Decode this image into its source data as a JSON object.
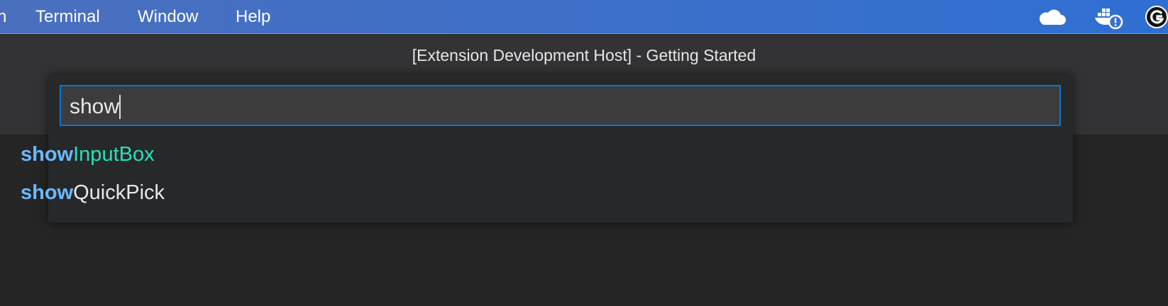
{
  "menubar": {
    "items": [
      {
        "label": "n"
      },
      {
        "label": "Terminal"
      },
      {
        "label": "Window"
      },
      {
        "label": "Help"
      }
    ],
    "tray_icons": [
      "onedrive-cloud-icon",
      "docker-warning-icon",
      "account-circle-icon"
    ]
  },
  "window": {
    "title": "[Extension Development Host] - Getting Started"
  },
  "quick_pick": {
    "input_value": "show",
    "items": [
      {
        "match": "show",
        "rest": "InputBox"
      },
      {
        "match": "show",
        "rest": "QuickPick"
      }
    ]
  },
  "colors": {
    "menubar": "#3f70c8",
    "input_border": "#0e74cf",
    "match_highlight": "#6ab9ff",
    "selected_item": "#29e0b8"
  }
}
